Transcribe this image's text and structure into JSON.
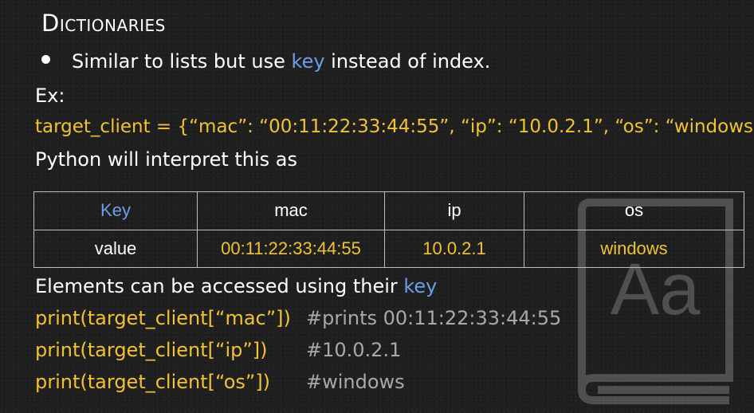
{
  "slide": {
    "title": "Dictionaries",
    "bullet": {
      "before": "Similar to lists but use ",
      "keyword": "key",
      "after": " instead of index."
    },
    "example_label": "Ex:",
    "code_line": "target_client = {“mac”: “00:11:22:33:44:55”, “ip”: “10.0.2.1”, “os”: “windows”}",
    "interpret_text": "Python will interpret this as",
    "table": {
      "header": [
        "Key",
        "mac",
        "ip",
        "os"
      ],
      "row": [
        "value",
        "00:11:22:33:44:55",
        "10.0.2.1",
        "windows"
      ]
    },
    "access": {
      "before": "Elements can be accessed using their ",
      "keyword": "key"
    },
    "print_lines": [
      {
        "code": "print(target_client[“mac”])",
        "comment": "#prints 00:11:22:33:44:55"
      },
      {
        "code": "print(target_client[“ip”])",
        "comment": "#10.0.2.1"
      },
      {
        "code": "print(target_client[“os”])",
        "comment": "#windows"
      }
    ],
    "watermark_icon": "dictionary-book-icon",
    "watermark_text": "Aa"
  },
  "colors": {
    "background": "#1f1f1f",
    "text": "#ffffff",
    "keyword_blue": "#6d9eeb",
    "code_yellow": "#f1c232",
    "comment_grey": "#a9a9a9"
  }
}
